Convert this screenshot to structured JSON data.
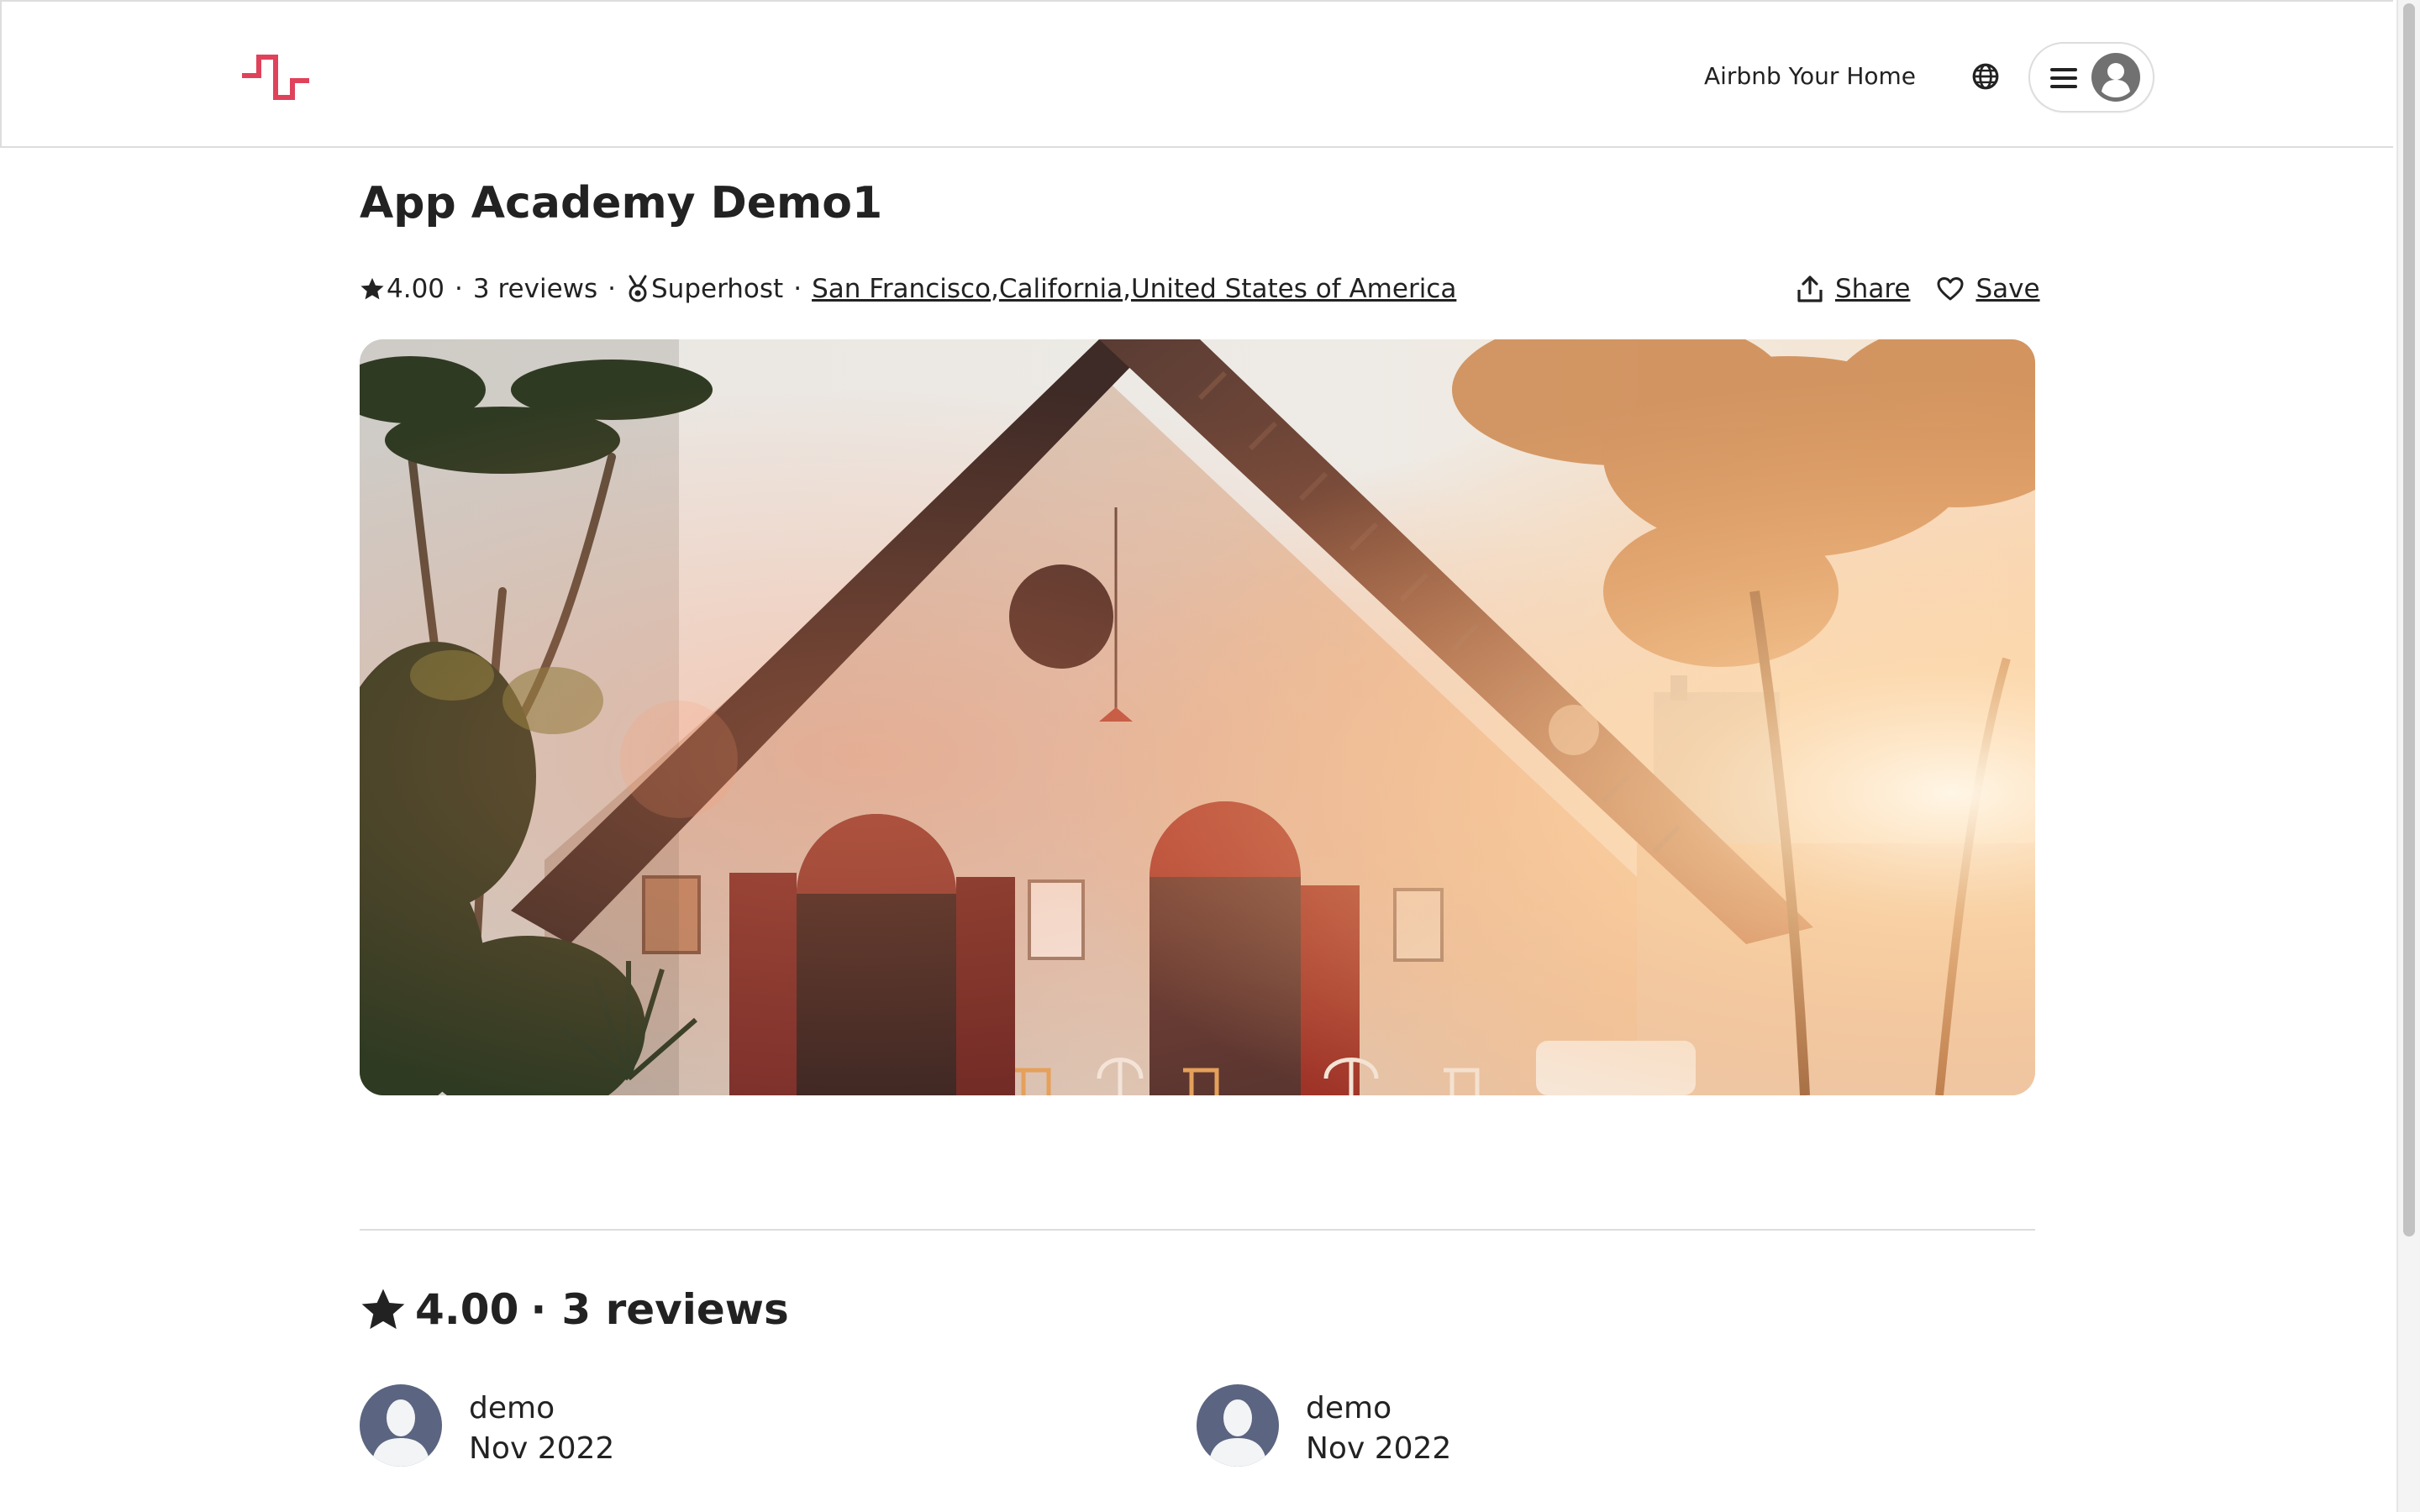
{
  "header": {
    "logo_icon": "brand-wave-logo-icon",
    "brand_color": "#E0425B",
    "host_link": "Airbnb Your Home",
    "globe_icon": "globe-icon",
    "menu_icon": "hamburger-menu-icon",
    "avatar_icon": "user-avatar-icon"
  },
  "listing": {
    "title": "App Academy Demo1",
    "rating": "4.00",
    "review_count_text": "3 reviews",
    "dot": "·",
    "superhost_label": "Superhost",
    "city": "San Francisco",
    "state": "California",
    "country": "United States of America",
    "comma": ",",
    "share_label": "Share",
    "save_label": "Save"
  },
  "reviews": {
    "rating": "4.00",
    "dot": "·",
    "count_text": "3 reviews",
    "items": [
      {
        "name": "demo",
        "date": "Nov 2022"
      },
      {
        "name": "demo",
        "date": "Nov 2022"
      }
    ]
  }
}
